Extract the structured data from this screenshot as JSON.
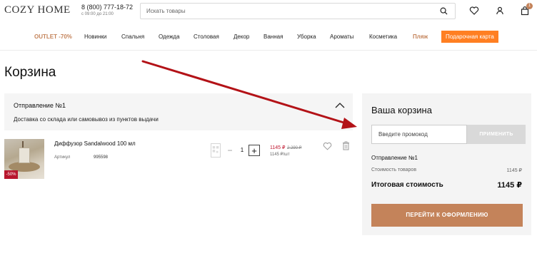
{
  "header": {
    "logo": "COZY HOME",
    "phone": "8 (800) 777-18-72",
    "hours": "с 09:00 до 21:00",
    "search_placeholder": "Искать товары",
    "cart_count": "1"
  },
  "nav": {
    "items": [
      "OUTLET -70%",
      "Новинки",
      "Спальня",
      "Одежда",
      "Столовая",
      "Декор",
      "Ванная",
      "Уборка",
      "Ароматы",
      "Косметика",
      "Пляж",
      "Подарочная карта"
    ]
  },
  "page_title": "Корзина",
  "shipment": {
    "title": "Отправление №1",
    "subtitle": "Доставка со склада или самовывоз из пунктов выдачи"
  },
  "product": {
    "name": "Диффузор Sandalwood 100 мл",
    "discount": "-50%",
    "sku_label": "Артикул",
    "sku_value": "995598",
    "quantity": "1",
    "price_new": "1145 ₽",
    "price_old": "2 290 ₽",
    "price_unit": "1145 ₽/шт"
  },
  "summary": {
    "title": "Ваша корзина",
    "promo_placeholder": "Введите промокод",
    "apply_label": "ПРИМЕНИТЬ",
    "shipment_label": "Отправление №1",
    "goods_label": "Стоимость товаров",
    "goods_value": "1145 ₽",
    "total_label": "Итоговая стоимость",
    "total_value": "1145 ₽",
    "checkout_label": "ПЕРЕЙТИ К ОФОРМЛЕНИЮ"
  },
  "colors": {
    "accent": "#c4835a",
    "gift": "#ff7f22",
    "sale": "#c0162f",
    "arrow": "#b31217"
  }
}
